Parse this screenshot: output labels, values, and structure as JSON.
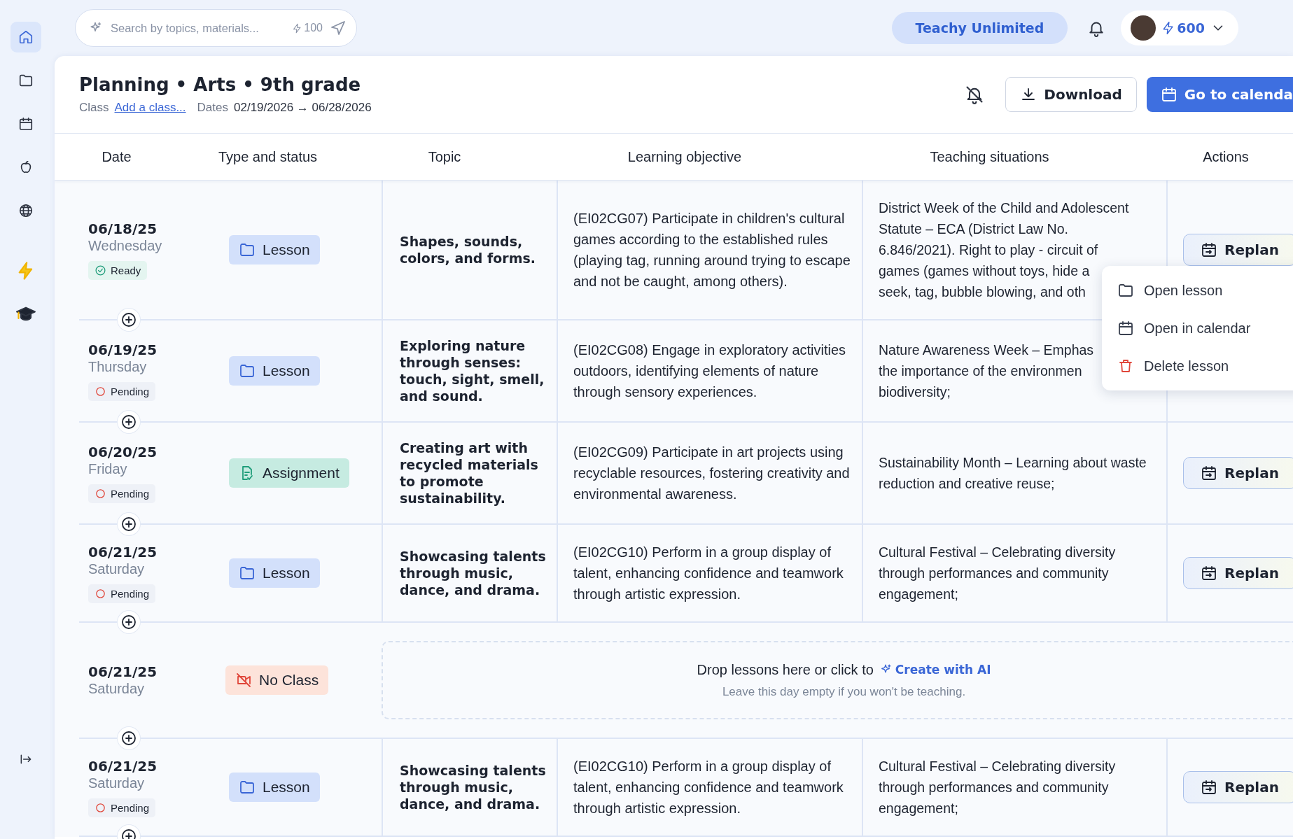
{
  "sidebar": {
    "items": [
      {
        "selected": true
      },
      {
        "selected": false
      },
      {
        "selected": false
      },
      {
        "selected": false
      },
      {
        "selected": false
      },
      {
        "selected": false
      },
      {
        "selected": false
      }
    ]
  },
  "search": {
    "placeholder": "Search by topics, materials...",
    "credits": "100"
  },
  "plan_badge": "Teachy Unlimited",
  "user": {
    "credits": "600"
  },
  "header": {
    "title": "Planning • Arts • 9th grade",
    "class_label": "Class",
    "class_link": "Add a class...",
    "dates_label": "Dates",
    "dates": "02/19/2026 → 06/28/2026",
    "buttons": [
      {
        "kind": "outline",
        "label": "Download"
      },
      {
        "kind": "primary",
        "label": "Go to calenda"
      }
    ]
  },
  "table": {
    "columns": [
      "Date",
      "Type and status",
      "Topic",
      "Learning objective",
      "Teaching situations",
      "Actions"
    ],
    "rows": [
      {
        "kind": "planned",
        "date": "06/18/25",
        "weekday": "Wednesday",
        "status": {
          "kind": "ready",
          "label": "Ready"
        },
        "type": {
          "kind": "lesson",
          "label": "Lesson"
        },
        "topic": "Shapes, sounds, colors, and forms.",
        "objective": "(EI02CG07) Participate in children's cultural games according to the established rules (playing tag, running around trying to escape and not be caught, among others).",
        "teaching": [
          "District Week of the Child and Adolescent\nStatute – ECA (District Law No.\n6.846/2021). Right to play - circuit of",
          "games (games without toys, hide a\nseek, tag, bubble blowing, and oth"
        ],
        "action": "Replan"
      },
      {
        "kind": "planned",
        "date": "06/19/25",
        "weekday": "Thursday",
        "status": {
          "kind": "pending",
          "label": "Pending"
        },
        "type": {
          "kind": "lesson",
          "label": "Lesson"
        },
        "topic": "Exploring nature through senses: touch, sight, smell, and sound.",
        "objective": "(EI02CG08) Engage in exploratory activities outdoors, identifying elements of nature through sensory experiences.",
        "teaching": "Nature Awareness Week – Emphas\nthe importance of the environmen\nbiodiversity;"
      },
      {
        "kind": "planned",
        "date": "06/20/25",
        "weekday": "Friday",
        "status": {
          "kind": "pending",
          "label": "Pending"
        },
        "type": {
          "kind": "assignment",
          "label": "Assignment"
        },
        "topic": "Creating art with recycled materials to promote sustainability.",
        "objective": "(EI02CG09) Participate in art projects using recyclable resources, fostering creativity and environmental awareness.",
        "teaching": "Sustainability Month – Learning about waste reduction and creative reuse;",
        "action": "Replan"
      },
      {
        "kind": "planned",
        "date": "06/21/25",
        "weekday": "Saturday",
        "status": {
          "kind": "pending",
          "label": "Pending"
        },
        "type": {
          "kind": "lesson",
          "label": "Lesson"
        },
        "topic": "Showcasing talents through music, dance, and drama.",
        "objective": "(EI02CG10) Perform in a group display of talent, enhancing confidence and teamwork through artistic expression.",
        "teaching": "Cultural Festival – Celebrating diversity through performances and community engagement;",
        "action": "Replan"
      },
      {
        "kind": "empty",
        "date": "06/21/25",
        "weekday": "Saturday",
        "type": {
          "kind": "noclass",
          "label": "No Class"
        },
        "drop_text": "Drop lessons here or click to",
        "ai_link": "Create with AI",
        "hint": "Leave this day empty if you won't be teaching."
      },
      {
        "kind": "planned",
        "date": "06/21/25",
        "weekday": "Saturday",
        "status": {
          "kind": "pending",
          "label": "Pending"
        },
        "type": {
          "kind": "lesson",
          "label": "Lesson"
        },
        "topic": "Showcasing talents through music, dance, and drama.",
        "objective": "(EI02CG10) Perform in a group display of talent, enhancing confidence and teamwork through artistic expression.",
        "teaching": "Cultural Festival – Celebrating diversity through performances and community engagement;",
        "action": "Replan"
      }
    ]
  },
  "context_menu": {
    "items": [
      {
        "kind": "folder",
        "label": "Open lesson"
      },
      {
        "kind": "calendar",
        "label": "Open in calendar"
      },
      {
        "kind": "danger",
        "label": "Delete lesson"
      }
    ]
  }
}
